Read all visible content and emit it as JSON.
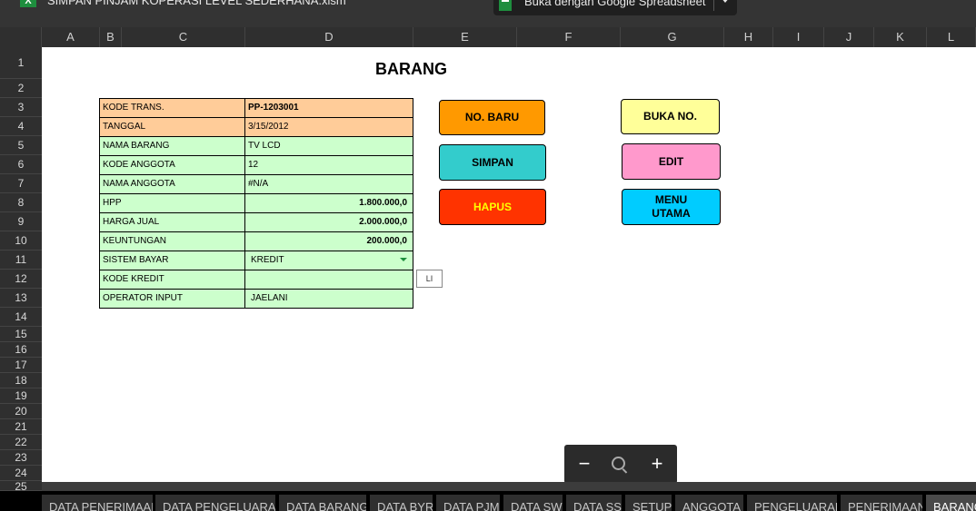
{
  "window": {
    "filename": "SIMPAN PINJAM KOPERASI LEVEL SEDERHANA.xlsm",
    "open_with": "Buka dengan Google Spreadsheet"
  },
  "columns": [
    "A",
    "B",
    "C",
    "D",
    "E",
    "F",
    "G",
    "H",
    "I",
    "J",
    "K",
    "L"
  ],
  "rows": [
    "1",
    "2",
    "3",
    "4",
    "5",
    "6",
    "7",
    "8",
    "9",
    "10",
    "11",
    "12",
    "13",
    "14",
    "15",
    "16",
    "17",
    "18",
    "19",
    "20",
    "21",
    "22",
    "23",
    "24",
    "25"
  ],
  "sheet_title": "BARANG",
  "form": {
    "fields": [
      {
        "label": "KODE TRANS.",
        "value": "PP-1203001"
      },
      {
        "label": "TANGGAL",
        "value": "3/15/2012"
      },
      {
        "label": "NAMA BARANG",
        "value": "TV LCD"
      },
      {
        "label": "KODE ANGGOTA",
        "value": "12"
      },
      {
        "label": "NAMA ANGGOTA",
        "value": "#N/A"
      },
      {
        "label": "HPP",
        "value": "1.800.000,0"
      },
      {
        "label": "HARGA JUAL",
        "value": "2.000.000,0"
      },
      {
        "label": "KEUNTUNGAN",
        "value": "200.000,0"
      },
      {
        "label": "SISTEM BAYAR",
        "value": "KREDIT"
      },
      {
        "label": "KODE KREDIT",
        "value": ""
      },
      {
        "label": "OPERATOR INPUT",
        "value": "JAELANI"
      }
    ]
  },
  "small_box": "LI",
  "buttons": {
    "no_baru": "NO. BARU",
    "simpan": "SIMPAN",
    "hapus": "HAPUS",
    "buka_no": "BUKA NO.",
    "edit": "EDIT",
    "menu_utama": "MENU UTAMA"
  },
  "colors": {
    "orange_fill": "#ffcc99",
    "green_fill": "#ccffcc",
    "no_baru": "#ff9900",
    "simpan": "#33cccc",
    "hapus": "#ff3300",
    "hapus_text": "#ffff00",
    "buka_no": "#ffff99",
    "edit": "#ff99cc",
    "menu_utama": "#00ccff"
  },
  "zoom": {
    "zoom_out": "−",
    "zoom_in": "+"
  },
  "tabs": [
    "DATA PENERIMAAN",
    "DATA PENGELUARAN",
    "DATA BARANG",
    "DATA BYR",
    "DATA PJM",
    "DATA SW",
    "DATA SS",
    "SETUP",
    "ANGGOTA",
    "PENGELUARAN",
    "PENERIMAAN",
    "BARANG"
  ]
}
